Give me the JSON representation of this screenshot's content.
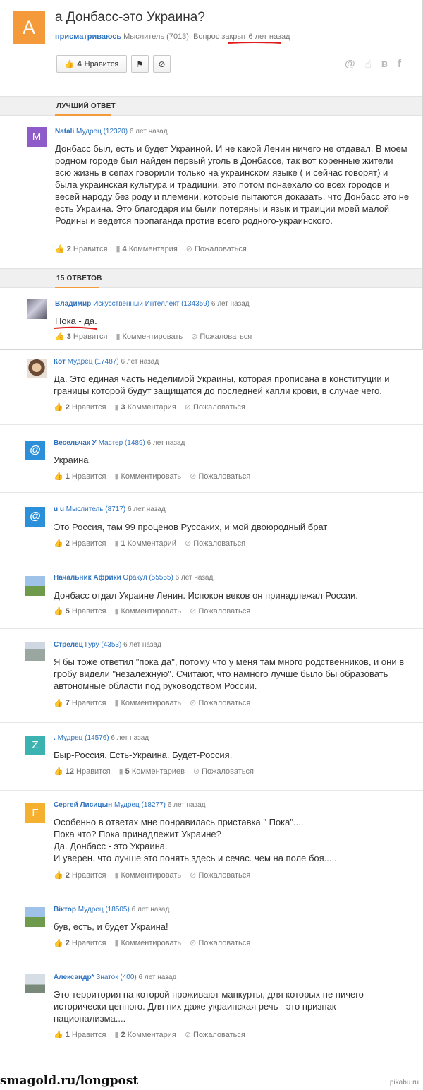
{
  "question": {
    "avatar_letter": "A",
    "title": "а Донбасс-это Украина?",
    "author": "присматриваюсь",
    "author_rank": "Мыслитель (7013),",
    "status": "Вопрос закрыт",
    "time": "6 лет назад",
    "likes": "4",
    "like_label": "Нравится",
    "share_icons": [
      "at-icon",
      "ok-icon",
      "vk-icon",
      "facebook-icon"
    ]
  },
  "best_answer": {
    "section_label": "ЛУЧШИЙ ОТВЕТ",
    "avatar_letter": "M",
    "author": "Natali",
    "rank": "Мудрец (12320)",
    "time": "6 лет назад",
    "text": "Донбасс был, есть и будет Украиной. И не какой Ленин ничего не отдавал, В моем родном городе был найден первый уголь в Донбассе, так вот коренные жители всю жизнь в сепах говорили только на украинском языке ( и сейчас говорят) и была украинская культура и традиции, это потом понаехало со всех городов и весей народу без роду и племени, которые пытаются доказать, что Донбасс это не есть Украина. Это благодаря им были потеряны и язык и траиции моей малой Родины и ведется пропаганда против всего родного-украинского.",
    "likes": "2",
    "like_label": "Нравится",
    "comments": "4",
    "comments_label": "Комментария",
    "report": "Пожаловаться"
  },
  "answers_label": "15 ОТВЕТОВ",
  "answers": [
    {
      "avatar_letter": "",
      "author": "Владимир",
      "rank": "Искусственный Интеллект (134359)",
      "time": "6 лет назад",
      "text": "Пока - да.",
      "likes": "3",
      "like_label": "Нравится",
      "comments": "",
      "comments_label": "Комментировать",
      "report": "Пожаловаться"
    },
    {
      "avatar_letter": "",
      "author": "Кот",
      "rank": "Мудрец (17487)",
      "time": "6 лет назад",
      "text": "Да. Это единая часть неделимой Украины, которая прописана в конституции и границы которой будут защищатся до последней капли крови, в случае чего.",
      "likes": "2",
      "like_label": "Нравится",
      "comments": "3",
      "comments_label": "Комментария",
      "report": "Пожаловаться"
    },
    {
      "avatar_letter": "@",
      "author": "Весельчак У",
      "rank": "Мастер (1489)",
      "time": "6 лет назад",
      "text": "Украина",
      "likes": "1",
      "like_label": "Нравится",
      "comments": "",
      "comments_label": "Комментировать",
      "report": "Пожаловаться"
    },
    {
      "avatar_letter": "@",
      "author": "u u",
      "rank": "Мыслитель (8717)",
      "time": "6 лет назад",
      "text": "Это Россия, там 99 проценов Руссаких, и мой двоюродный брат",
      "likes": "2",
      "like_label": "Нравится",
      "comments": "1",
      "comments_label": "Комментарий",
      "report": "Пожаловаться"
    },
    {
      "avatar_letter": "",
      "author": "Начальник Африки",
      "rank": "Оракул (55555)",
      "time": "6 лет назад",
      "text": "Донбасс отдал Украине Ленин. Испокон веков он принадлежал России.",
      "likes": "5",
      "like_label": "Нравится",
      "comments": "",
      "comments_label": "Комментировать",
      "report": "Пожаловаться"
    },
    {
      "avatar_letter": "",
      "author": "Стрелец",
      "rank": "Гуру (4353)",
      "time": "6 лет назад",
      "text": "Я бы тоже ответил \"пока да\", потому что у меня там много родственников, и они в гробу видели \"незалежную\". Считают, что намного лучше было бы образовать автономные области под руководством России.",
      "likes": "7",
      "like_label": "Нравится",
      "comments": "",
      "comments_label": "Комментировать",
      "report": "Пожаловаться"
    },
    {
      "avatar_letter": "Z",
      "author": ".",
      "rank": "Мудрец (14576)",
      "time": "6 лет назад",
      "text": "Быp-Россия. Есть-Украина. Будет-Россия.",
      "likes": "12",
      "like_label": "Нравится",
      "comments": "5",
      "comments_label": "Комментариев",
      "report": "Пожаловаться"
    },
    {
      "avatar_letter": "F",
      "author": "Сергей Лисицын",
      "rank": "Мудрец (18277)",
      "time": "6 лет назад",
      "text": "Особенно в ответах мне понравилась приставка \" Пока\"....\nПока что? Пока принадлежит Украине?\nДа. Донбасс - это Украина.\nИ уверен. что лучше это понять здесь и сечас. чем на поле боя... .",
      "likes": "2",
      "like_label": "Нравится",
      "comments": "",
      "comments_label": "Комментировать",
      "report": "Пожаловаться"
    },
    {
      "avatar_letter": "",
      "author": "Віктор",
      "rank": "Мудрец (18505)",
      "time": "6 лет назад",
      "text": "був, есть, и будет Украина!",
      "likes": "2",
      "like_label": "Нравится",
      "comments": "",
      "comments_label": "Комментировать",
      "report": "Пожаловаться"
    },
    {
      "avatar_letter": "",
      "author": "Александр*",
      "rank": "Знаток (400)",
      "time": "6 лет назад",
      "text": "Это территория на которой проживают манкурты, для которых не ничего исторически ценного. Для них даже украинская речь - это признак национализма....",
      "likes": "1",
      "like_label": "Нравится",
      "comments": "2",
      "comments_label": "Комментария",
      "report": "Пожаловаться"
    }
  ],
  "footer": {
    "left": "smagold.ru/longpost",
    "right": "pikabu.ru"
  },
  "colors": {
    "accent": "#f59a3a",
    "link": "#2f74c0",
    "best_avatar": "#8e5bc8",
    "z_avatar": "#3cb3b0",
    "f_avatar": "#f5b030",
    "at_avatar": "#2b8fd9"
  }
}
